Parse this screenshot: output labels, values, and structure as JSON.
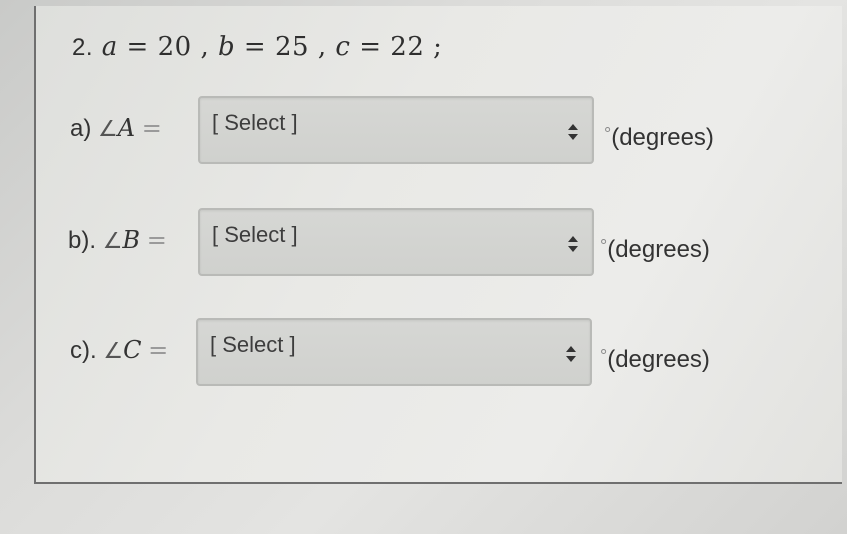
{
  "question": {
    "number": "2.",
    "a_label": "a",
    "a_value": "20",
    "b_label": "b",
    "b_value": "25",
    "c_label": "c",
    "c_value": "22",
    "terminator": ";"
  },
  "rows": [
    {
      "prefix": "a)",
      "angle_symbol": "∠",
      "angle_var": "A",
      "equals": "=",
      "select_value": "[ Select ]",
      "degree_symbol": "°",
      "unit": "(degrees)"
    },
    {
      "prefix": "b).",
      "angle_symbol": "∠",
      "angle_var": "B",
      "equals": "=",
      "select_value": "[ Select ]",
      "degree_symbol": "°",
      "unit": "(degrees)"
    },
    {
      "prefix": "c).",
      "angle_symbol": "∠",
      "angle_var": "C",
      "equals": "=",
      "select_value": "[ Select ]",
      "degree_symbol": "°",
      "unit": "(degrees)"
    }
  ],
  "icons": {
    "dropdown": "up-down-chevron-icon"
  }
}
